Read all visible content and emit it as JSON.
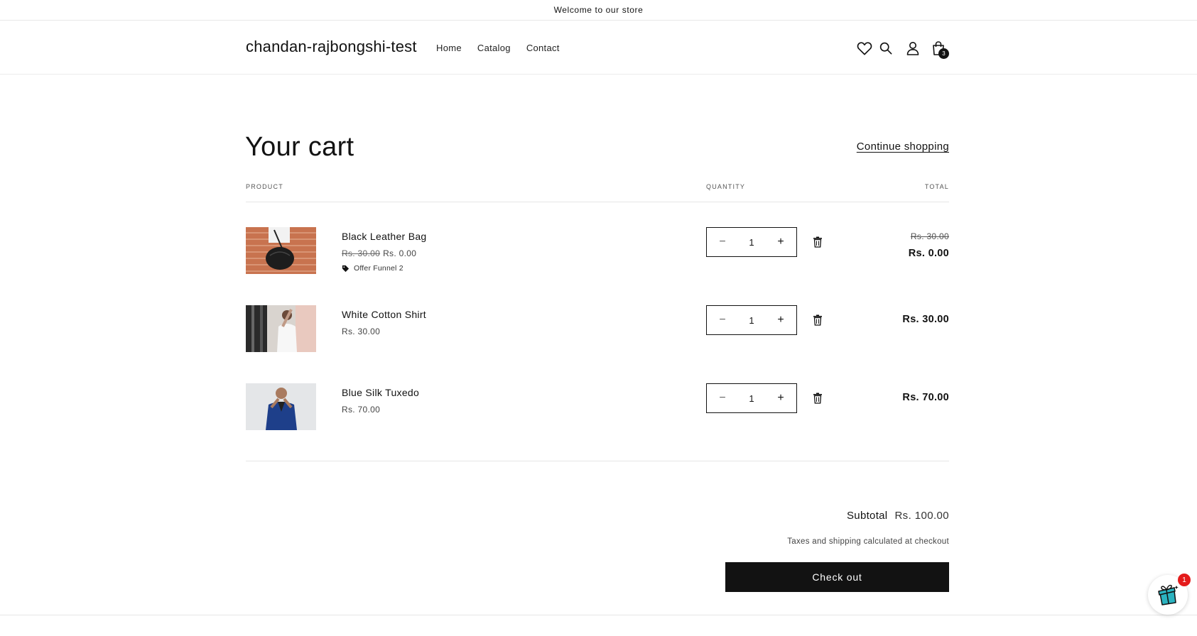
{
  "announcement": "Welcome to our store",
  "header": {
    "logo": "chandan-rajbongshi-test",
    "nav": [
      "Home",
      "Catalog",
      "Contact"
    ],
    "cart_count": "3"
  },
  "cart": {
    "title": "Your cart",
    "continue_label": "Continue shopping",
    "columns": {
      "product": "PRODUCT",
      "quantity": "QUANTITY",
      "total": "TOTAL"
    },
    "items": [
      {
        "name": "Black Leather Bag",
        "price_old": "Rs. 30.00",
        "price": "Rs. 0.00",
        "offer": "Offer Funnel 2",
        "quantity": "1",
        "total_old": "Rs. 30.00",
        "total": "Rs. 0.00"
      },
      {
        "name": "White Cotton Shirt",
        "price": "Rs. 30.00",
        "quantity": "1",
        "total": "Rs. 30.00"
      },
      {
        "name": "Blue Silk Tuxedo",
        "price": "Rs. 70.00",
        "quantity": "1",
        "total": "Rs. 70.00"
      }
    ],
    "subtotal_label": "Subtotal",
    "subtotal_value": "Rs. 100.00",
    "tax_note": "Taxes and shipping calculated at checkout",
    "checkout_label": "Check out"
  },
  "widget": {
    "badge": "1"
  },
  "colors": {
    "primary": "#121212",
    "badge_red": "#e41b1b",
    "accent_teal": "#2bb3c0"
  },
  "icons": [
    "heart-icon",
    "search-icon",
    "account-icon",
    "cart-icon",
    "minus-icon",
    "plus-icon",
    "trash-icon",
    "tag-icon",
    "gift-icon"
  ]
}
